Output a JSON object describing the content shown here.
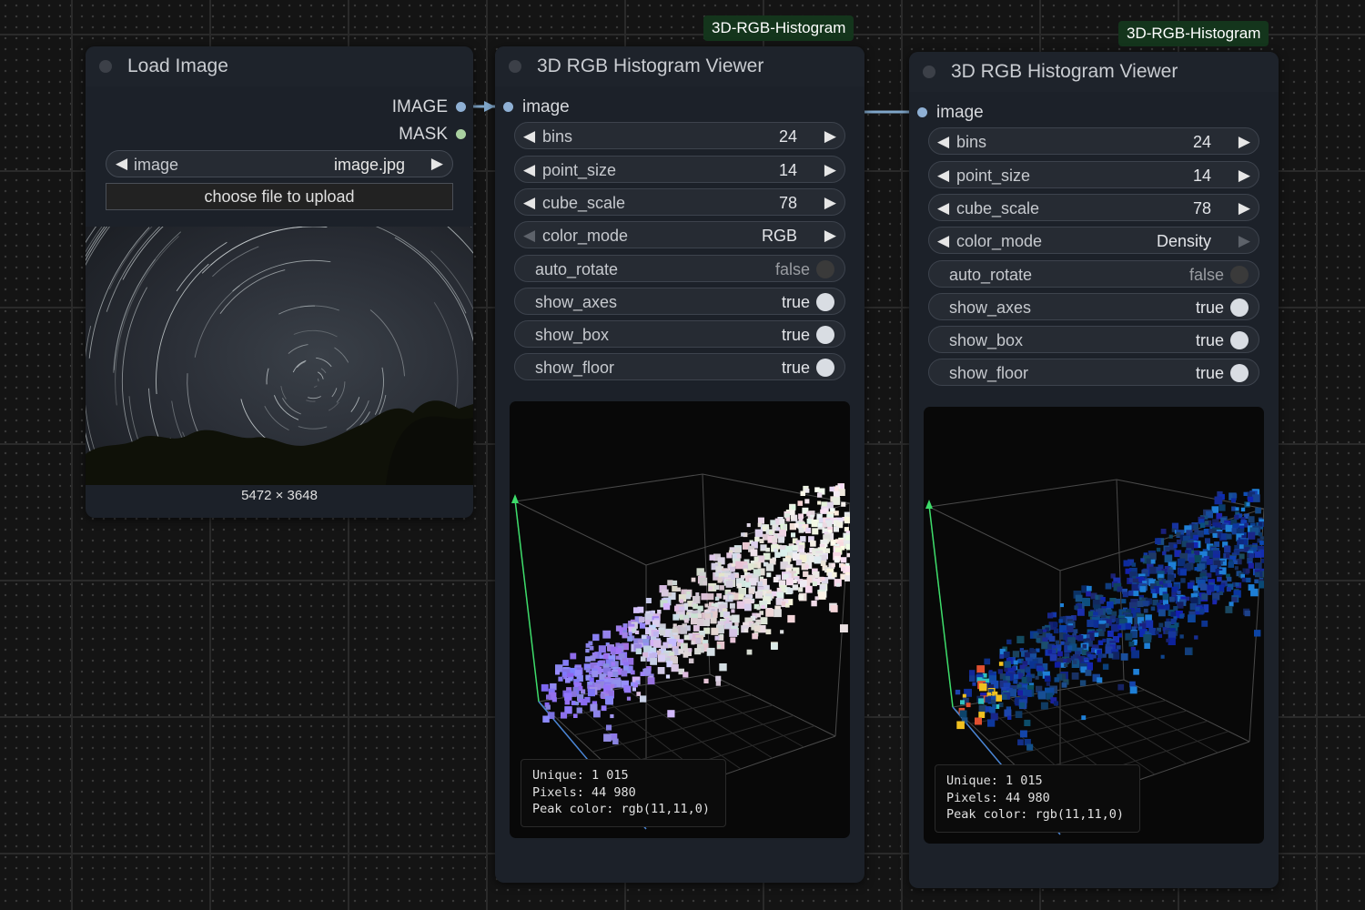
{
  "nodes": {
    "load_image": {
      "title": "Load Image",
      "outputs": [
        "IMAGE",
        "MASK"
      ],
      "image_widget": {
        "label": "image",
        "value": "image.jpg"
      },
      "upload_label": "choose file to upload",
      "dimensions": "5472 × 3648"
    },
    "viewer1": {
      "tag": "3D-RGB-Histogram",
      "title": "3D RGB Histogram Viewer",
      "input": "image",
      "widgets": {
        "bins": {
          "label": "bins",
          "value": "24"
        },
        "point_size": {
          "label": "point_size",
          "value": "14"
        },
        "cube_scale": {
          "label": "cube_scale",
          "value": "78"
        },
        "color_mode": {
          "label": "color_mode",
          "value": "RGB"
        },
        "auto_rotate": {
          "label": "auto_rotate",
          "value": "false"
        },
        "show_axes": {
          "label": "show_axes",
          "value": "true"
        },
        "show_box": {
          "label": "show_box",
          "value": "true"
        },
        "show_floor": {
          "label": "show_floor",
          "value": "true"
        }
      },
      "stats": {
        "unique": "Unique: 1 015",
        "pixels": "Pixels: 44 980",
        "peak": "Peak color: rgb(11,11,0)"
      }
    },
    "viewer2": {
      "tag": "3D-RGB-Histogram",
      "title": "3D RGB Histogram Viewer",
      "input": "image",
      "widgets": {
        "bins": {
          "label": "bins",
          "value": "24"
        },
        "point_size": {
          "label": "point_size",
          "value": "14"
        },
        "cube_scale": {
          "label": "cube_scale",
          "value": "78"
        },
        "color_mode": {
          "label": "color_mode",
          "value": "Density"
        },
        "auto_rotate": {
          "label": "auto_rotate",
          "value": "false"
        },
        "show_axes": {
          "label": "show_axes",
          "value": "true"
        },
        "show_box": {
          "label": "show_box",
          "value": "true"
        },
        "show_floor": {
          "label": "show_floor",
          "value": "true"
        }
      },
      "stats": {
        "unique": "Unique: 1 015",
        "pixels": "Pixels: 44 980",
        "peak": "Peak color: rgb(11,11,0)"
      }
    }
  },
  "colors": {
    "canvas": "#141414",
    "node_body": "#1c2129",
    "tag_bg": "#14351c",
    "image_slot": "#8fb0d4",
    "mask_slot": "#a9d0a0",
    "link": "#7fa6c9",
    "axis_y": "#3ddc6a",
    "axis_x": "#4b86d6"
  },
  "icons": {
    "decrement": "left-triangle-icon",
    "increment": "right-triangle-icon",
    "toggle": "toggle-knob-icon",
    "node_collapse": "circle-dot-icon"
  }
}
